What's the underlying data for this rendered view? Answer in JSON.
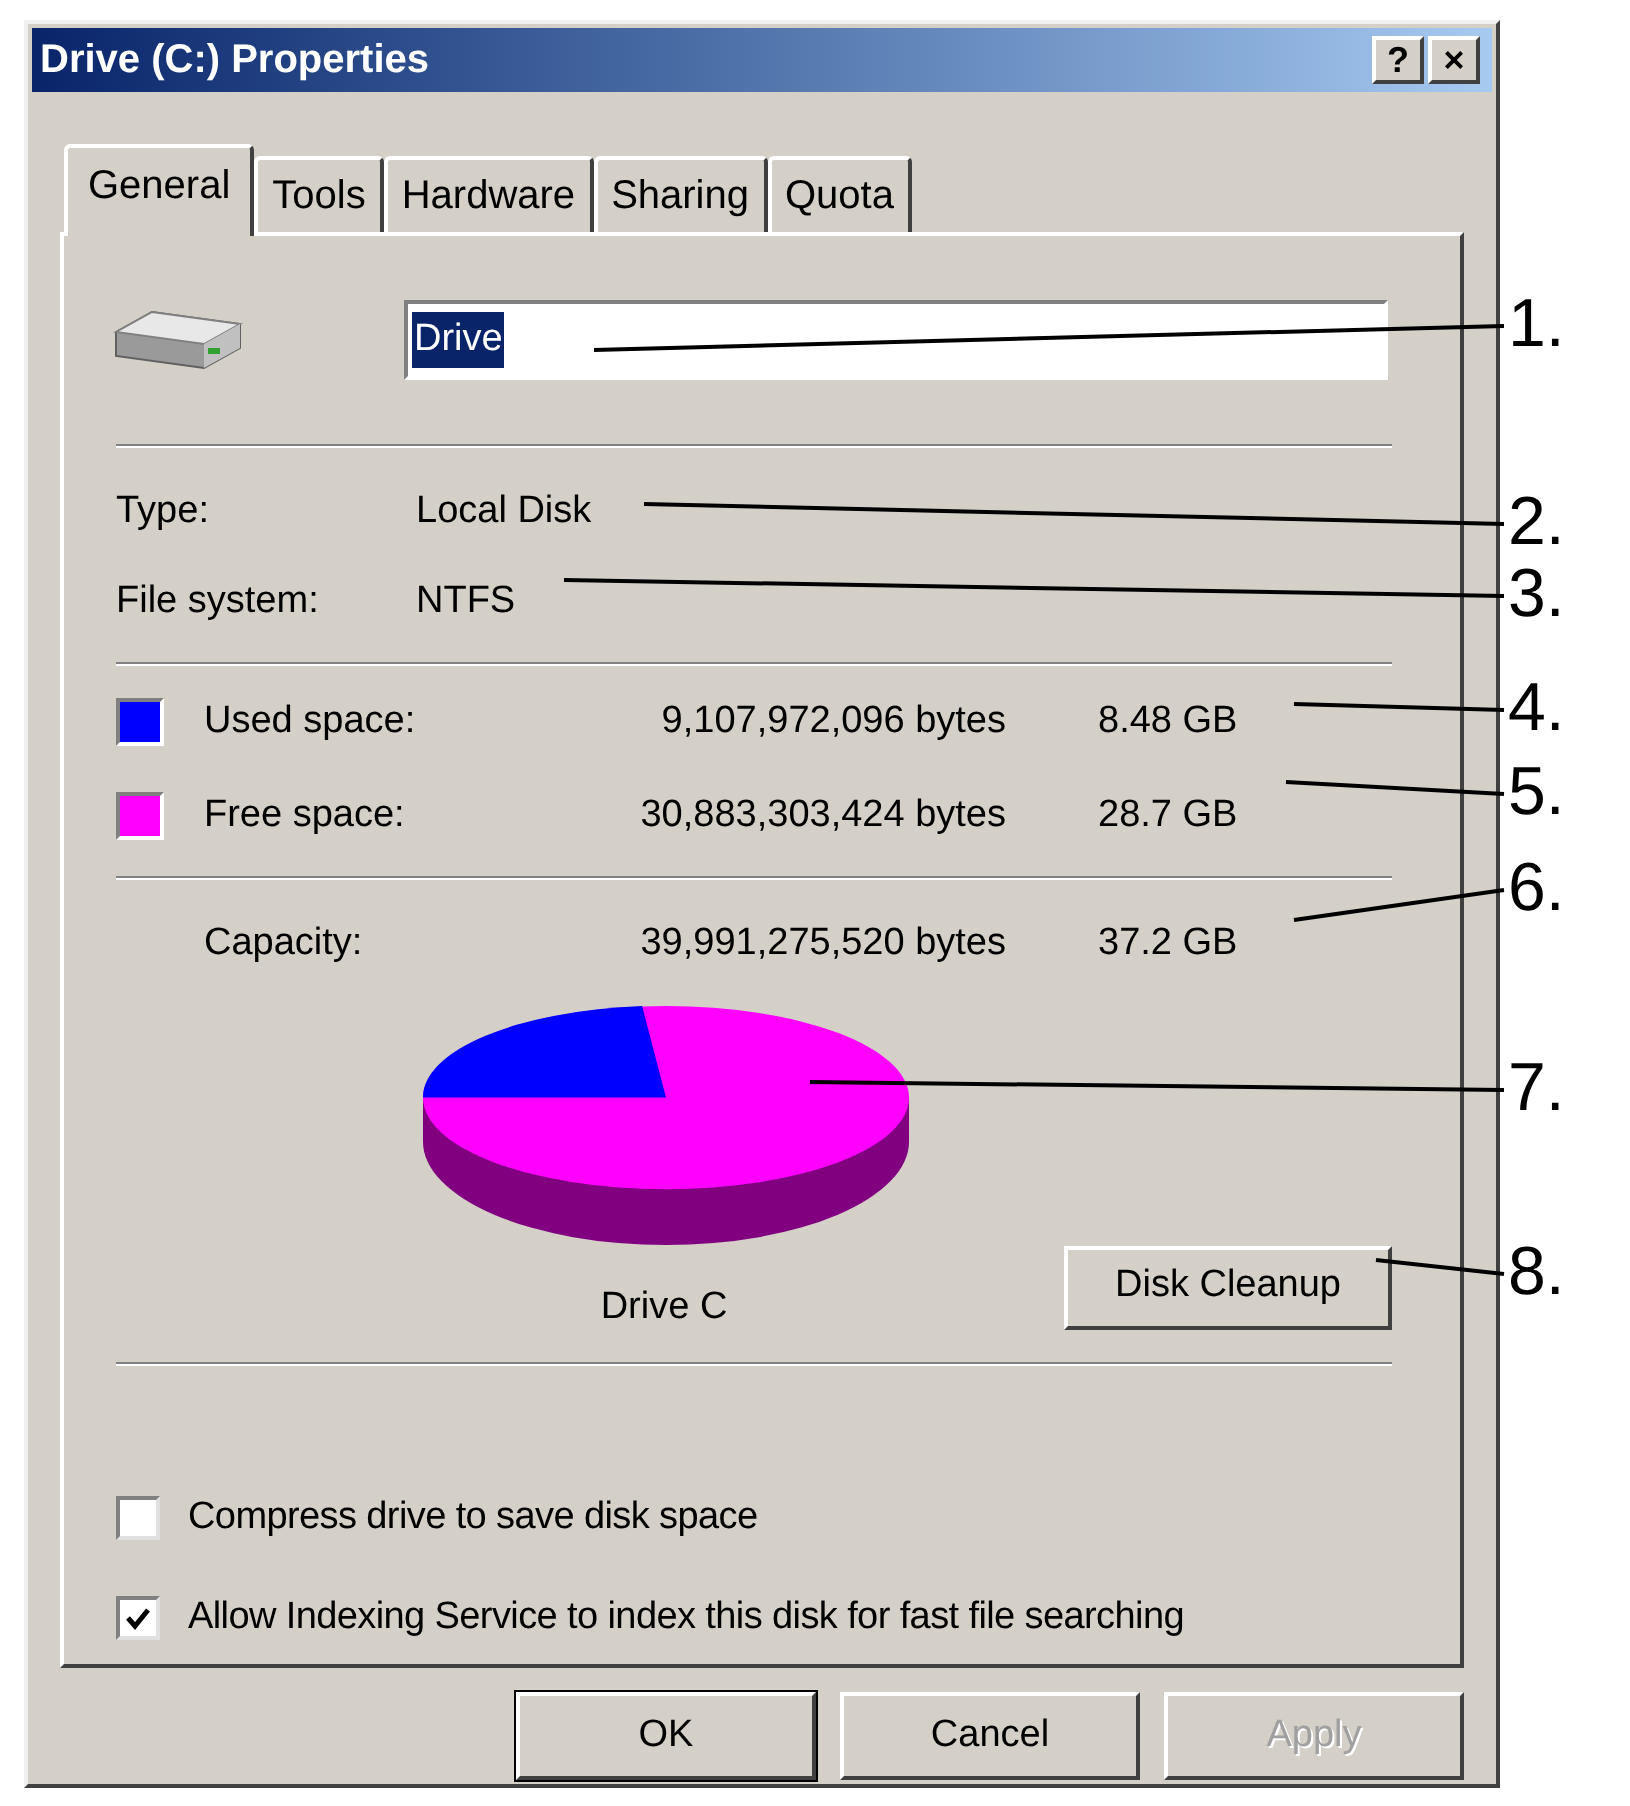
{
  "window": {
    "title": "Drive (C:) Properties",
    "title_buttons": [
      "?",
      "×"
    ]
  },
  "tabs": [
    {
      "label": "General",
      "selected": true
    },
    {
      "label": "Tools",
      "selected": false
    },
    {
      "label": "Hardware",
      "selected": false
    },
    {
      "label": "Sharing",
      "selected": false
    },
    {
      "label": "Quota",
      "selected": false
    }
  ],
  "name_field": {
    "value": "Drive",
    "text_selected": true
  },
  "properties": [
    {
      "label": "Type:",
      "value": "Local Disk"
    },
    {
      "label": "File system:",
      "value": "NTFS"
    }
  ],
  "space": [
    {
      "label": "Used space:",
      "bytes": "9,107,972,096 bytes",
      "size": "8.48 GB",
      "color": "#0000ff"
    },
    {
      "label": "Free space:",
      "bytes": "30,883,303,424 bytes",
      "size": "28.7 GB",
      "color": "#ff00ff"
    }
  ],
  "capacity": {
    "label": "Capacity:",
    "bytes": "39,991,275,520 bytes",
    "size": "37.2 GB"
  },
  "pie_label": "Drive C",
  "cleanup_button": "Disk Cleanup",
  "checkboxes": [
    {
      "label": "Compress drive to save disk space",
      "checked": false
    },
    {
      "label": "Allow Indexing Service to index this disk for fast file searching",
      "checked": true
    }
  ],
  "buttons": [
    {
      "label": "OK",
      "disabled": false,
      "default": true
    },
    {
      "label": "Cancel",
      "disabled": false,
      "default": false
    },
    {
      "label": "Apply",
      "disabled": true,
      "default": false
    }
  ],
  "callouts": [
    "1.",
    "2.",
    "3.",
    "4.",
    "5.",
    "6.",
    "7.",
    "8."
  ]
}
